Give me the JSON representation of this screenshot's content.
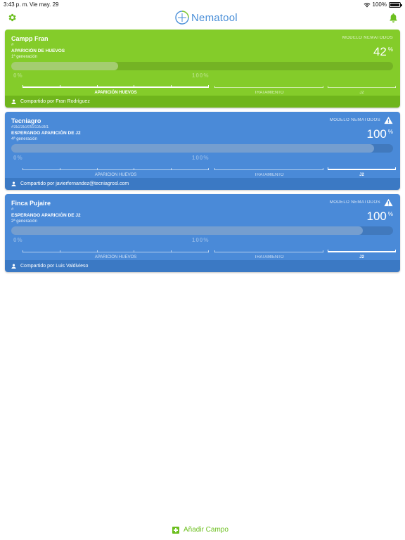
{
  "status_bar": {
    "time": "3:43 p. m.",
    "date": "Vie may. 29",
    "battery": "100%"
  },
  "header": {
    "title": "Nematool",
    "settings_icon": "gear-icon",
    "notifications_icon": "bell-icon",
    "brand_color": "#4a8fd8",
    "accent_color": "#6cbf1f"
  },
  "model_label": "MODELO NEMATODOS",
  "scale_ghost": {
    "start": "0%",
    "end": "100%"
  },
  "timeline_labels": [
    "APARICIÓN HUEVOS",
    "TRATAMIENTO",
    "J2"
  ],
  "fields": [
    {
      "name": "Campp Fran",
      "code": "#",
      "phase": "APARICIÓN DE HUEVOS",
      "generation": "1ª generación",
      "percent": "42",
      "progress": 0.28,
      "active_stage": 0,
      "warning": false,
      "theme": "green",
      "shared_by": "Compartido por Fran Rodríguez"
    },
    {
      "name": "Tecniagro",
      "code": "#352353093135381",
      "phase": "ESPERANDO APARICIÓN DE J2",
      "generation": "4ª generación",
      "percent": "100",
      "progress": 0.95,
      "active_stage": 2,
      "warning": true,
      "theme": "blue",
      "shared_by": "Compartido por javierfernandez@tecniagrosl.com"
    },
    {
      "name": "Finca Pujaire",
      "code": "#",
      "phase": "ESPERANDO APARICIÓN DE J2",
      "generation": "2ª generación",
      "percent": "100",
      "progress": 0.92,
      "active_stage": 2,
      "warning": true,
      "theme": "blue",
      "shared_by": "Compartido por Luis Valdivieso"
    }
  ],
  "add_button": {
    "label": "Añadir Campo"
  }
}
